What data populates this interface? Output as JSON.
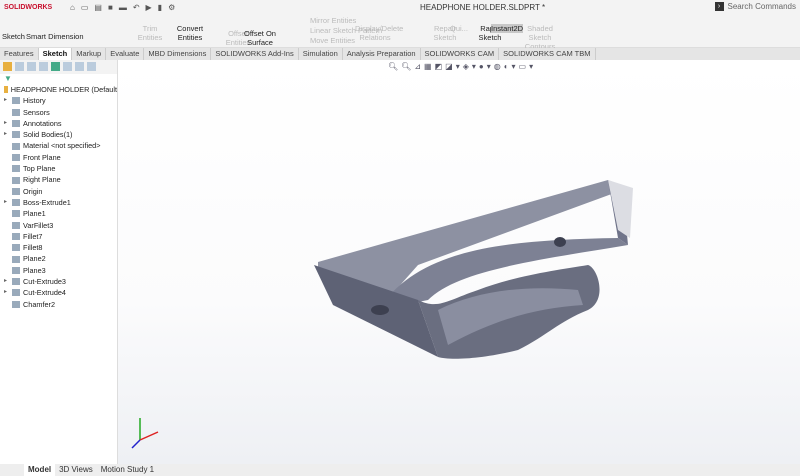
{
  "app": {
    "logo": "SOLIDWORKS",
    "title": "HEADPHONE HOLDER.SLDPRT *",
    "search_placeholder": "Search Commands"
  },
  "ribbon": [
    {
      "label": "Sketch",
      "enabled": true
    },
    {
      "label": "Smart Dimension",
      "enabled": true
    },
    {
      "label": "Trim Entities",
      "enabled": false
    },
    {
      "label": "Convert Entities",
      "enabled": true
    },
    {
      "label": "Offset Entities",
      "enabled": false
    },
    {
      "label": "Offset On Surface",
      "enabled": true
    },
    {
      "label": "Mirror Entities",
      "enabled": false
    },
    {
      "label": "Linear Sketch Pattern",
      "enabled": false
    },
    {
      "label": "Move Entities",
      "enabled": false
    },
    {
      "label": "Display/Delete Relations",
      "enabled": false
    },
    {
      "label": "Repair Sketch",
      "enabled": false
    },
    {
      "label": "Qui...",
      "enabled": false
    },
    {
      "label": "Rapid Sketch",
      "enabled": true
    },
    {
      "label": "Instant2D",
      "enabled": true
    },
    {
      "label": "Shaded Sketch Contours",
      "enabled": false
    }
  ],
  "tabs": [
    "Features",
    "Sketch",
    "Markup",
    "Evaluate",
    "MBD Dimensions",
    "SOLIDWORKS Add-Ins",
    "Simulation",
    "Analysis Preparation",
    "SOLIDWORKS CAM",
    "SOLIDWORKS CAM TBM"
  ],
  "active_tab": "Sketch",
  "tree": {
    "root": "HEADPHONE HOLDER  (Default",
    "items": [
      {
        "label": "History",
        "expand": true
      },
      {
        "label": "Sensors",
        "expand": false
      },
      {
        "label": "Annotations",
        "expand": true
      },
      {
        "label": "Solid Bodies(1)",
        "expand": true
      },
      {
        "label": "Material <not specified>",
        "expand": false
      },
      {
        "label": "Front Plane",
        "expand": false
      },
      {
        "label": "Top Plane",
        "expand": false
      },
      {
        "label": "Right Plane",
        "expand": false
      },
      {
        "label": "Origin",
        "expand": false
      },
      {
        "label": "Boss-Extrude1",
        "expand": true
      },
      {
        "label": "Plane1",
        "expand": false
      },
      {
        "label": "VarFillet3",
        "expand": false
      },
      {
        "label": "Fillet7",
        "expand": false
      },
      {
        "label": "Fillet8",
        "expand": false
      },
      {
        "label": "Plane2",
        "expand": false
      },
      {
        "label": "Plane3",
        "expand": false
      },
      {
        "label": "Cut-Extrude3",
        "expand": true
      },
      {
        "label": "Cut-Extrude4",
        "expand": true
      },
      {
        "label": "Chamfer2",
        "expand": false
      }
    ]
  },
  "bottom_tabs": [
    "Model",
    "3D Views",
    "Motion Study 1"
  ],
  "colors": {
    "part": "#6a6e80",
    "brand": "#c8102e"
  }
}
